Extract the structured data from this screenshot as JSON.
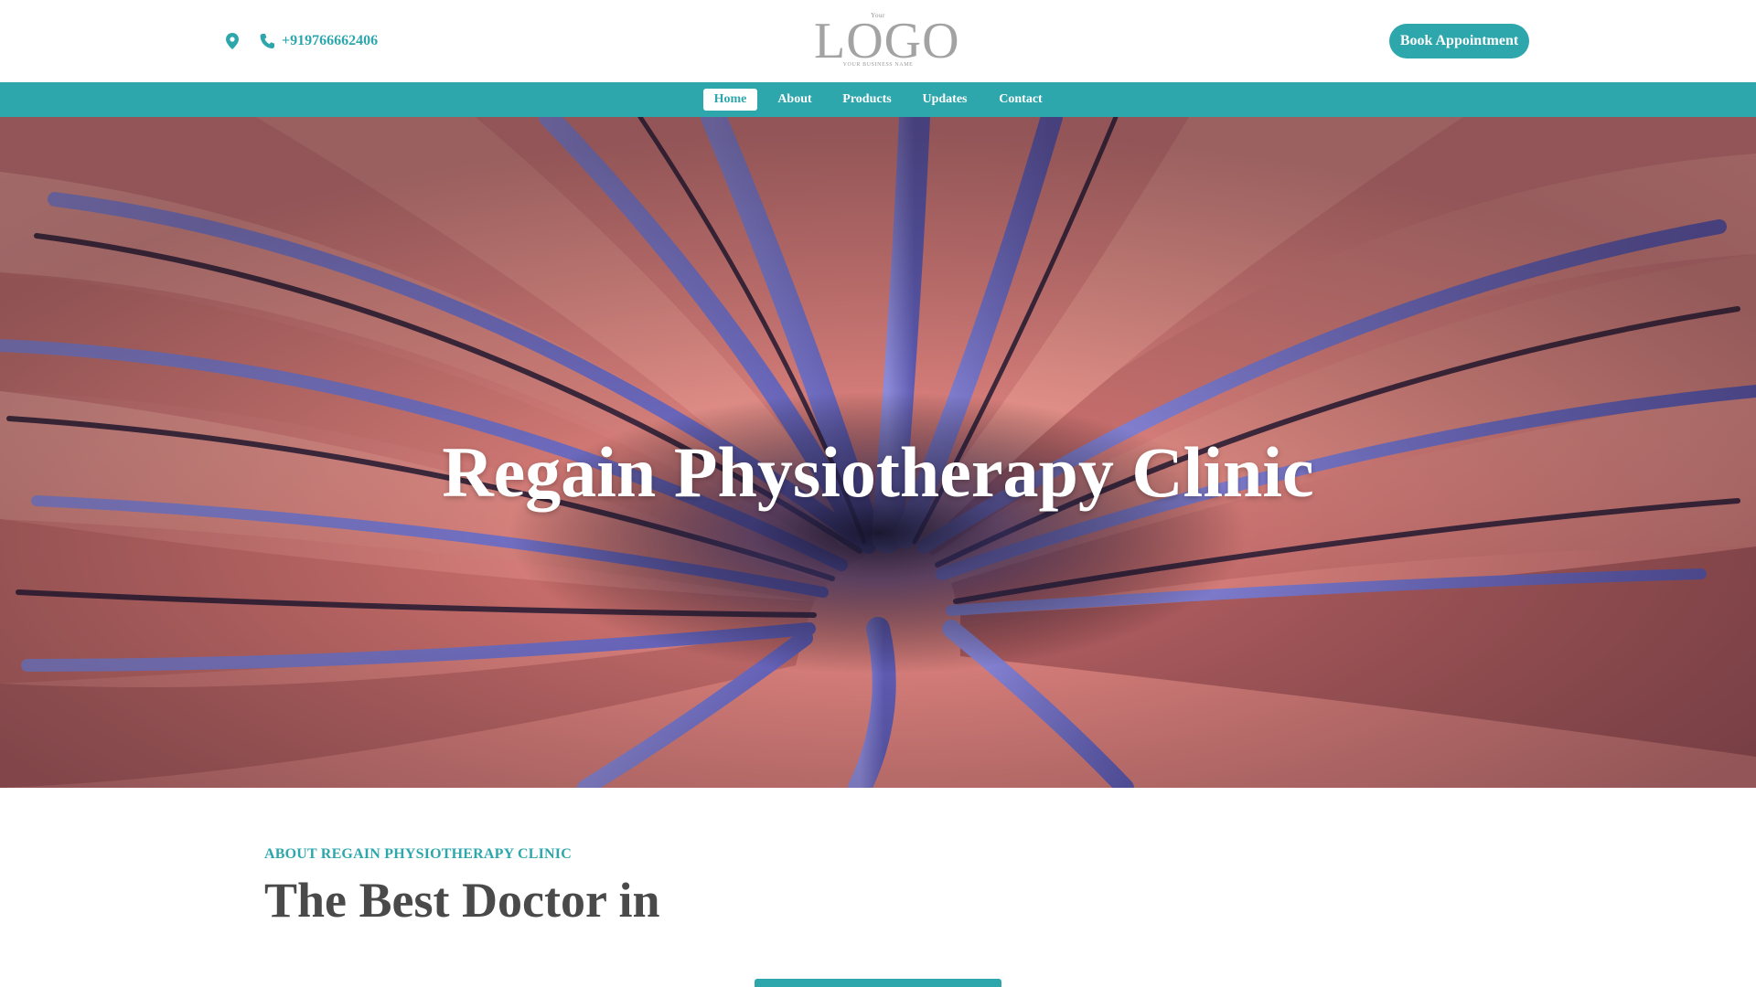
{
  "header": {
    "phone": "+919766662406",
    "logo": {
      "small_text": "Your",
      "main_text": "LOGO",
      "sub_text": "YOUR BUSINESS NAME"
    },
    "book_button_label": "Book Appointment"
  },
  "nav": {
    "items": [
      {
        "label": "Home",
        "active": true
      },
      {
        "label": "About",
        "active": false
      },
      {
        "label": "Products",
        "active": false
      },
      {
        "label": "Updates",
        "active": false
      },
      {
        "label": "Contact",
        "active": false
      }
    ]
  },
  "hero": {
    "title": "Regain Physiotherapy Clinic"
  },
  "about": {
    "kicker": "ABOUT REGAIN PHYSIOTHERAPY CLINIC",
    "heading": "The Best Doctor in"
  },
  "colors": {
    "accent": "#2ea7ac",
    "heading_text": "#4a4a4a",
    "hero_pink": "#d67e7a",
    "hero_violet": "#7a78c8"
  },
  "icons": {
    "location": "map-pin-icon",
    "phone": "phone-icon"
  }
}
